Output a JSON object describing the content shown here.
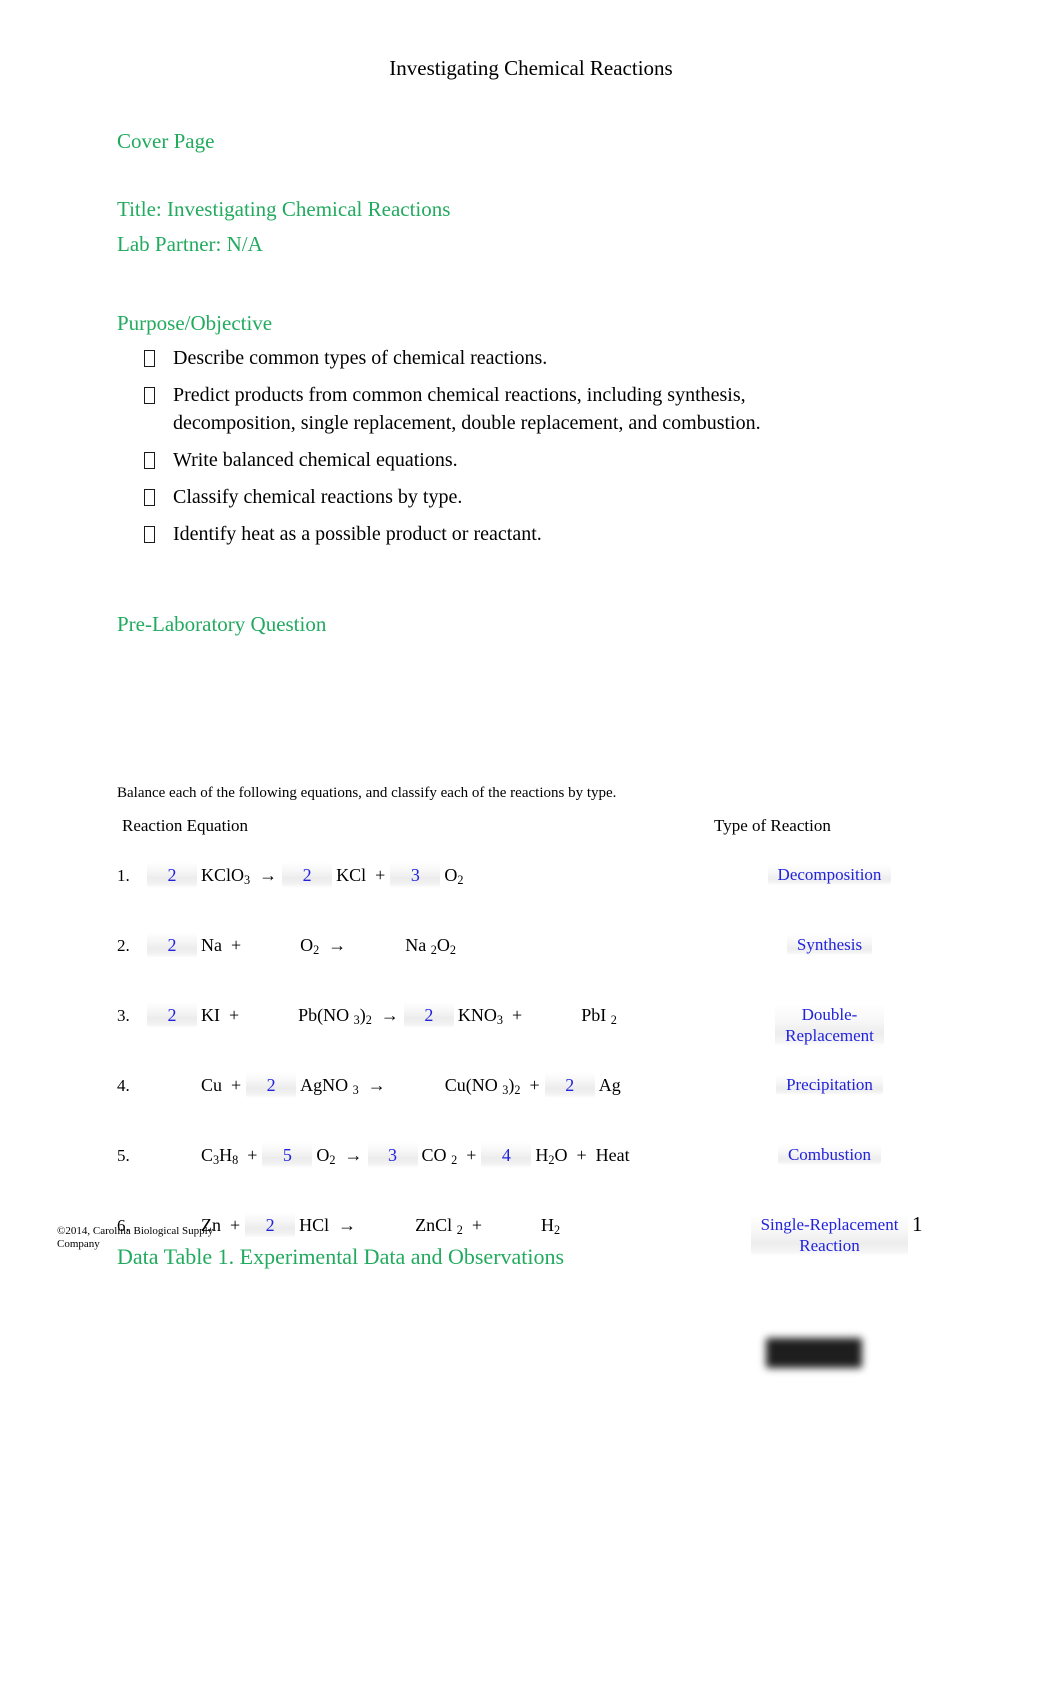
{
  "document": {
    "running_title": "Investigating Chemical Reactions",
    "page_number": "1",
    "footer_copyright": "©2014, Carolina Biological Supply Company"
  },
  "cover": {
    "section_heading": "Cover Page",
    "title_line": "Title: Investigating Chemical Reactions",
    "partner_line": "Lab Partner: N/A"
  },
  "purpose": {
    "heading": "Purpose/Objective",
    "objectives": [
      "Describe common types of chemical reactions.",
      "Predict products from common chemical reactions, including synthesis, decomposition, single replacement, double replacement, and combustion.",
      "Write balanced chemical equations.",
      "Classify chemical reactions by type.",
      "Identify heat as a possible product or reactant."
    ]
  },
  "prelab": {
    "heading": "Pre-Laboratory Question",
    "instruction": "Balance each of the following equations, and classify each of the reactions by type.",
    "columns": {
      "equation": "Reaction Equation",
      "type": "Type of Reaction"
    },
    "rows": [
      {
        "number": "1.",
        "coefficients": [
          "2",
          "",
          "2",
          "",
          "3",
          ""
        ],
        "species": [
          "KClO",
          "KCl",
          "O"
        ],
        "terms": [
          {
            "coef": "2",
            "formula_main": "KClO",
            "formula_sub": "3"
          },
          {
            "coef": "2",
            "formula_main": "KCl",
            "formula_sub": ""
          },
          {
            "coef": "3",
            "formula_main": "O",
            "formula_sub": "2"
          }
        ],
        "type_answer": "Decomposition",
        "type_answer_line2": ""
      },
      {
        "number": "2.",
        "terms": [
          {
            "coef": "2",
            "formula_main": "Na",
            "formula_sub": ""
          },
          {
            "coef": "",
            "formula_main": "O",
            "formula_sub": "2"
          },
          {
            "coef": "",
            "formula_main": "Na",
            "formula_sub": "2",
            "formula_tail": "O",
            "formula_tail_sub": "2"
          }
        ],
        "type_answer": "Synthesis",
        "type_answer_line2": ""
      },
      {
        "number": "3.",
        "terms": [
          {
            "coef": "2",
            "formula_main": "KI",
            "formula_sub": ""
          },
          {
            "coef": "",
            "formula_main": "Pb(NO",
            "formula_sub": "3",
            "formula_tail": ")",
            "formula_tail_sub": "2"
          },
          {
            "coef": "2",
            "formula_main": "KNO",
            "formula_sub": "3"
          },
          {
            "coef": "",
            "formula_main": "PbI",
            "formula_sub": "2"
          }
        ],
        "type_answer": "Double-",
        "type_answer_line2": "Replacement"
      },
      {
        "number": "4.",
        "terms": [
          {
            "coef": "",
            "formula_main": "Cu",
            "formula_sub": ""
          },
          {
            "coef": "2",
            "formula_main": "AgNO",
            "formula_sub": "3"
          },
          {
            "coef": "",
            "formula_main": "Cu(NO",
            "formula_sub": "3",
            "formula_tail": ")",
            "formula_tail_sub": "2"
          },
          {
            "coef": "2",
            "formula_main": "Ag",
            "formula_sub": ""
          }
        ],
        "type_answer": "Precipitation",
        "type_answer_line2": ""
      },
      {
        "number": "5.",
        "terms": [
          {
            "coef": "",
            "formula_main": "C",
            "formula_sub": "3",
            "formula_tail": "H",
            "formula_tail_sub": "8"
          },
          {
            "coef": "5",
            "formula_main": "O",
            "formula_sub": "2"
          },
          {
            "coef": "3",
            "formula_main": "CO",
            "formula_sub": "2"
          },
          {
            "coef": "4",
            "formula_main": "H",
            "formula_sub": "2",
            "formula_tail": "O",
            "formula_tail_sub": ""
          },
          {
            "coef": "",
            "formula_main": "Heat",
            "formula_sub": ""
          }
        ],
        "type_answer": "Combustion",
        "type_answer_line2": ""
      },
      {
        "number": "6.",
        "terms": [
          {
            "coef": "",
            "formula_main": "Zn",
            "formula_sub": ""
          },
          {
            "coef": "2",
            "formula_main": "HCl",
            "formula_sub": ""
          },
          {
            "coef": "",
            "formula_main": "ZnCl",
            "formula_sub": "2"
          },
          {
            "coef": "",
            "formula_main": "H",
            "formula_sub": "2"
          }
        ],
        "type_answer": "Single-Replacement",
        "type_answer_line2": "Reaction"
      }
    ],
    "operators": {
      "plus": "+",
      "arrow": "→"
    }
  },
  "data_table": {
    "heading": "Data Table 1. Experimental Data and Observations"
  },
  "colors": {
    "heading_green": "#22aa5f",
    "answer_blue": "#2222dd",
    "body_black": "#000000",
    "redaction": "#1e1e1e"
  }
}
